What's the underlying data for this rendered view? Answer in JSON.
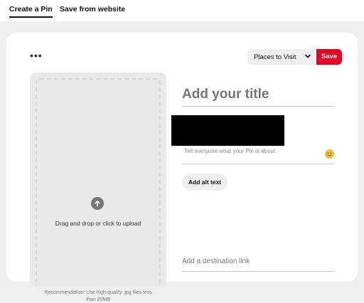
{
  "tabs": [
    {
      "label": "Create a Pin",
      "active": true
    },
    {
      "label": "Save from website",
      "active": false
    }
  ],
  "toolbar": {
    "more_icon": "more-horizontal-icon",
    "board_selected": "Places to Visit",
    "chevron_icon": "chevron-down-icon",
    "save_label": "Save"
  },
  "upload": {
    "icon": "arrow-up-circle-icon",
    "instruction": "Drag and drop or click to upload",
    "recommendation": "Recommendation: Use high-quality .jpg files less than 20MB"
  },
  "form": {
    "title_placeholder": "Add your title",
    "description_placeholder": "Tell everyone what your Pin is about",
    "emoji_icon": "smiley-emoji-icon",
    "alt_text_button": "Add alt text",
    "link_placeholder": "Add a destination link"
  },
  "colors": {
    "brand_red": "#e60023",
    "background": "#efefef",
    "card": "#ffffff",
    "placeholder_grey": "#767676"
  }
}
